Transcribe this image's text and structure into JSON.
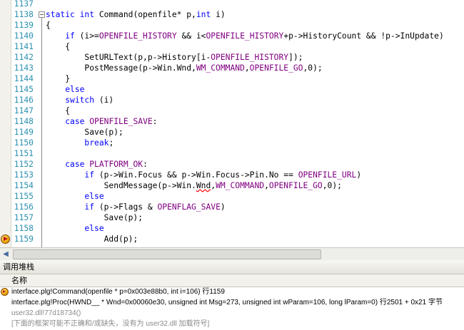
{
  "editor": {
    "lines": [
      {
        "num": "1137",
        "segs": []
      },
      {
        "num": "1138",
        "fold": "−",
        "segs": [
          {
            "t": "static",
            "c": "kw"
          },
          {
            "t": " "
          },
          {
            "t": "int",
            "c": "kw"
          },
          {
            "t": " Command(openfile* p,"
          },
          {
            "t": "int",
            "c": "kw"
          },
          {
            "t": " i)"
          }
        ]
      },
      {
        "num": "1139",
        "segs": [
          {
            "t": "{"
          }
        ]
      },
      {
        "num": "1140",
        "segs": [
          {
            "t": "    "
          },
          {
            "t": "if",
            "c": "kw"
          },
          {
            "t": " (i>="
          },
          {
            "t": "OPENFILE_HISTORY",
            "c": "mac"
          },
          {
            "t": " && i<"
          },
          {
            "t": "OPENFILE_HISTORY",
            "c": "mac"
          },
          {
            "t": "+p->HistoryCount && !p->InUpdate)"
          }
        ]
      },
      {
        "num": "1141",
        "segs": [
          {
            "t": "    {"
          }
        ]
      },
      {
        "num": "1142",
        "segs": [
          {
            "t": "        SetURLText(p,p->History[i-"
          },
          {
            "t": "OPENFILE_HISTORY",
            "c": "mac"
          },
          {
            "t": "]);"
          }
        ]
      },
      {
        "num": "1143",
        "segs": [
          {
            "t": "        PostMessage(p->Win.Wnd,"
          },
          {
            "t": "WM_COMMAND",
            "c": "mac"
          },
          {
            "t": ","
          },
          {
            "t": "OPENFILE_GO",
            "c": "mac"
          },
          {
            "t": ",0);"
          }
        ]
      },
      {
        "num": "1144",
        "segs": [
          {
            "t": "    }"
          }
        ]
      },
      {
        "num": "1145",
        "segs": [
          {
            "t": "    "
          },
          {
            "t": "else",
            "c": "kw"
          }
        ]
      },
      {
        "num": "1146",
        "segs": [
          {
            "t": "    "
          },
          {
            "t": "switch",
            "c": "kw"
          },
          {
            "t": " (i)"
          }
        ]
      },
      {
        "num": "1147",
        "segs": [
          {
            "t": "    {"
          }
        ]
      },
      {
        "num": "1148",
        "segs": [
          {
            "t": "    "
          },
          {
            "t": "case",
            "c": "kw"
          },
          {
            "t": " "
          },
          {
            "t": "OPENFILE_SAVE",
            "c": "mac"
          },
          {
            "t": ":"
          }
        ]
      },
      {
        "num": "1149",
        "segs": [
          {
            "t": "        Save(p);"
          }
        ]
      },
      {
        "num": "1150",
        "segs": [
          {
            "t": "        "
          },
          {
            "t": "break",
            "c": "kw"
          },
          {
            "t": ";"
          }
        ]
      },
      {
        "num": "1151",
        "segs": []
      },
      {
        "num": "1152",
        "segs": [
          {
            "t": "    "
          },
          {
            "t": "case",
            "c": "kw"
          },
          {
            "t": " "
          },
          {
            "t": "PLATFORM_OK",
            "c": "mac"
          },
          {
            "t": ":"
          }
        ]
      },
      {
        "num": "1153",
        "segs": [
          {
            "t": "        "
          },
          {
            "t": "if",
            "c": "kw"
          },
          {
            "t": " (p->Win.Focus && p->Win.Focus->Pin.No == "
          },
          {
            "t": "OPENFILE_URL",
            "c": "mac"
          },
          {
            "t": ")"
          }
        ]
      },
      {
        "num": "1154",
        "segs": [
          {
            "t": "            SendMessage(p->Win."
          },
          {
            "t": "Wnd",
            "w": true
          },
          {
            "t": ","
          },
          {
            "t": "WM_COMMAND",
            "c": "mac"
          },
          {
            "t": ","
          },
          {
            "t": "OPENFILE_GO",
            "c": "mac"
          },
          {
            "t": ",0);"
          }
        ]
      },
      {
        "num": "1155",
        "segs": [
          {
            "t": "        "
          },
          {
            "t": "else",
            "c": "kw"
          }
        ]
      },
      {
        "num": "1156",
        "segs": [
          {
            "t": "        "
          },
          {
            "t": "if",
            "c": "kw"
          },
          {
            "t": " (p->Flags & "
          },
          {
            "t": "OPENFLAG_SAVE",
            "c": "mac"
          },
          {
            "t": ")"
          }
        ]
      },
      {
        "num": "1157",
        "segs": [
          {
            "t": "            Save(p);"
          }
        ]
      },
      {
        "num": "1158",
        "segs": [
          {
            "t": "        "
          },
          {
            "t": "else",
            "c": "kw"
          }
        ]
      },
      {
        "num": "1159",
        "bp": true,
        "segs": [
          {
            "t": "            Add(p);"
          }
        ]
      },
      {
        "num": "",
        "segs": [
          {
            "t": "            "
          },
          {
            "t": "----- ------",
            "c": "mac"
          }
        ]
      }
    ]
  },
  "scroll": {
    "left_arrow": "◀"
  },
  "callstack": {
    "title": "调用堆栈",
    "column_name": "名称",
    "frames": [
      {
        "text": "interface.plg!Command(openfile * p=0x003e88b0, int i=106)  行1159",
        "current": true
      },
      {
        "text": "interface.plg!Proc(HWND__ * Wnd=0x00060e30, unsigned int Msg=273, unsigned int wParam=106, long lParam=0)  行2501 + 0x21 字节"
      },
      {
        "text": "user32.dll!77d18734()",
        "grey": true
      },
      {
        "text": "[下面的框架可能不正确和/或缺失，没有为 user32.dll 加载符号]",
        "grey": true
      }
    ]
  },
  "colors": {
    "keyword": "#0000ff",
    "macro": "#800080",
    "line_number": "#2b91af"
  }
}
